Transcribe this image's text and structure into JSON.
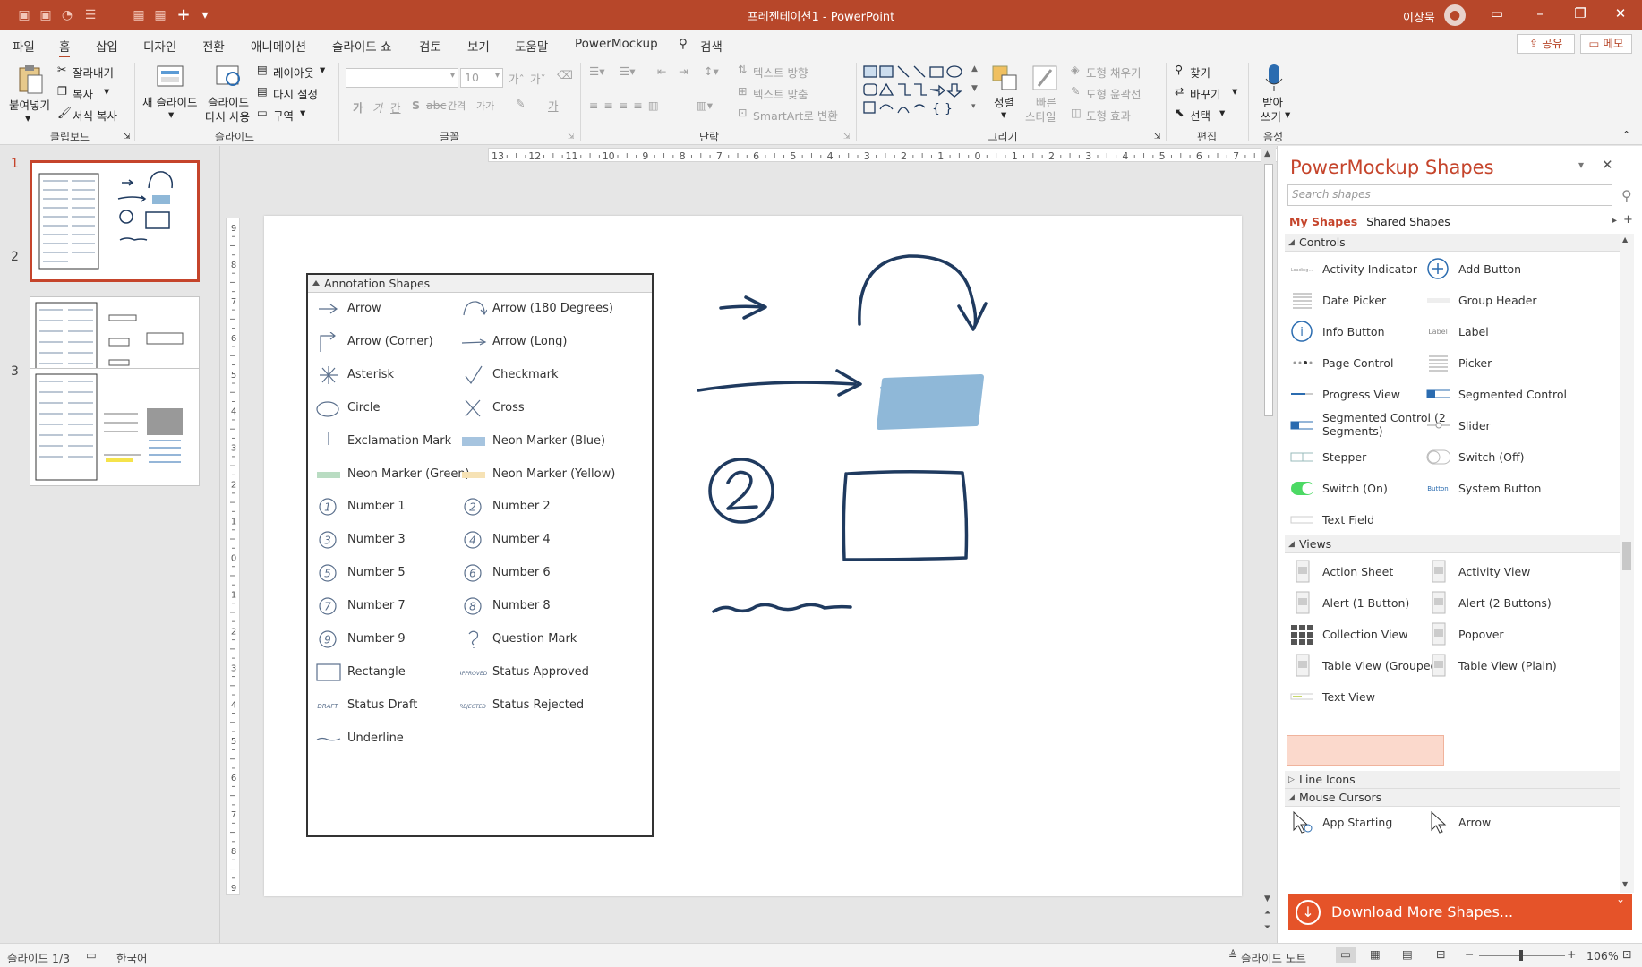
{
  "titlebar": {
    "title": "프레젠테이션1  -  PowerPoint",
    "user": "이상묵",
    "quick_access": [
      "save-icon",
      "undo-icon",
      "redo-icon",
      "list-icon",
      "grid-icon",
      "table-icon",
      "plus-icon",
      "customize-icon"
    ]
  },
  "menu": {
    "tabs": [
      "파일",
      "홈",
      "삽입",
      "디자인",
      "전환",
      "애니메이션",
      "슬라이드 쇼",
      "검토",
      "보기",
      "도움말",
      "PowerMockup"
    ],
    "search": "검색",
    "share": "공유",
    "memo": "메모"
  },
  "ribbon": {
    "clipboard": {
      "paste": "붙여넣기",
      "cut": "잘라내기",
      "copy": "복사",
      "format_painter": "서식 복사",
      "group": "클립보드"
    },
    "slides": {
      "new_slide": "새 슬라이드",
      "reuse_1": "슬라이드",
      "reuse_2": "다시 사용",
      "layout": "레이아웃",
      "reset": "다시 설정",
      "section": "구역",
      "group": "슬라이드"
    },
    "font": {
      "size": "10",
      "bold": "가",
      "italic": "가",
      "underline": "간",
      "strike": "S",
      "spacing": "간격",
      "case": "가가",
      "group": "글꼴"
    },
    "paragraph": {
      "text_direction": "텍스트 방향",
      "align_text": "텍스트 맞춤",
      "smartart": "SmartArt로 변환",
      "group": "단락"
    },
    "drawing": {
      "arrange": "정렬",
      "quick_1": "빠른",
      "quick_2": "스타일",
      "fill": "도형 채우기",
      "outline": "도형 윤곽선",
      "effect": "도형 효과",
      "group": "그리기"
    },
    "editing": {
      "find": "찾기",
      "replace": "바꾸기",
      "select": "선택",
      "group": "편집"
    },
    "voice": {
      "dictate_1": "받아",
      "dictate_2": "쓰기",
      "group": "음성"
    }
  },
  "slides": [
    {
      "num": "1"
    },
    {
      "num": "2"
    },
    {
      "num": "3"
    }
  ],
  "ruler": {
    "h_ticks": [
      "13",
      "12",
      "11",
      "10",
      "9",
      "8",
      "7",
      "6",
      "5",
      "4",
      "3",
      "2",
      "1",
      "0",
      "1",
      "2",
      "3",
      "4",
      "5",
      "6",
      "7",
      "8",
      "9",
      "10",
      "11",
      "12",
      "13"
    ],
    "v_ticks": [
      "9",
      "8",
      "7",
      "6",
      "5",
      "4",
      "3",
      "2",
      "1",
      "0",
      "1",
      "2",
      "3",
      "4",
      "5",
      "6",
      "7",
      "8",
      "9"
    ]
  },
  "annotation_panel": {
    "title": "Annotation Shapes",
    "items": [
      [
        "Arrow",
        "Arrow (180 Degrees)"
      ],
      [
        "Arrow (Corner)",
        "Arrow (Long)"
      ],
      [
        "Asterisk",
        "Checkmark"
      ],
      [
        "Circle",
        "Cross"
      ],
      [
        "Exclamation Mark",
        "Neon Marker (Blue)"
      ],
      [
        "Neon Marker (Green)",
        "Neon Marker (Yellow)"
      ],
      [
        "Number 1",
        "Number 2"
      ],
      [
        "Number 3",
        "Number 4"
      ],
      [
        "Number 5",
        "Number 6"
      ],
      [
        "Number 7",
        "Number 8"
      ],
      [
        "Number 9",
        "Question Mark"
      ],
      [
        "Rectangle",
        "Status Approved"
      ],
      [
        "Status Draft",
        "Status Rejected"
      ],
      [
        "Underline",
        ""
      ]
    ],
    "approved_tag": "APPROVED",
    "draft_tag": "DRAFT",
    "rejected_tag": "REJECTED"
  },
  "shapes_panel": {
    "title": "PowerMockup Shapes",
    "search_placeholder": "Search shapes",
    "tab_my": "My Shapes",
    "tab_shared": "Shared Shapes",
    "controls_title": "Controls",
    "controls": [
      [
        "Activity Indicator",
        "Add Button"
      ],
      [
        "Date Picker",
        "Group Header"
      ],
      [
        "Info Button",
        "Label"
      ],
      [
        "Page Control",
        "Picker"
      ],
      [
        "Progress View",
        "Segmented Control"
      ],
      [
        "Segmented Control (2 Segments)",
        "Slider"
      ],
      [
        "Stepper",
        "Switch (Off)"
      ],
      [
        "Switch (On)",
        "System Button"
      ],
      [
        "Text Field",
        ""
      ]
    ],
    "views_title": "Views",
    "views": [
      [
        "Action Sheet",
        "Activity View"
      ],
      [
        "Alert (1 Button)",
        "Alert (2 Buttons)"
      ],
      [
        "Collection View",
        "Popover"
      ],
      [
        "Table View (Grouped)",
        "Table View (Plain)"
      ],
      [
        "Text View",
        ""
      ]
    ],
    "line_icons_title": "Line Icons",
    "mouse_title": "Mouse Cursors",
    "mouse": [
      [
        "App Starting",
        "Arrow"
      ]
    ],
    "mini_label": "Label",
    "mini_button": "Button",
    "mini_loading": "Loading...",
    "download": "Download More Shapes..."
  },
  "status": {
    "slide": "슬라이드 1/3",
    "lang": "한국어",
    "notes": "슬라이드 노트",
    "zoom": "106%"
  },
  "colors": {
    "accent": "#b7472a",
    "ink": "#1f3a5f",
    "marker_blue": "#8fb8d8"
  }
}
